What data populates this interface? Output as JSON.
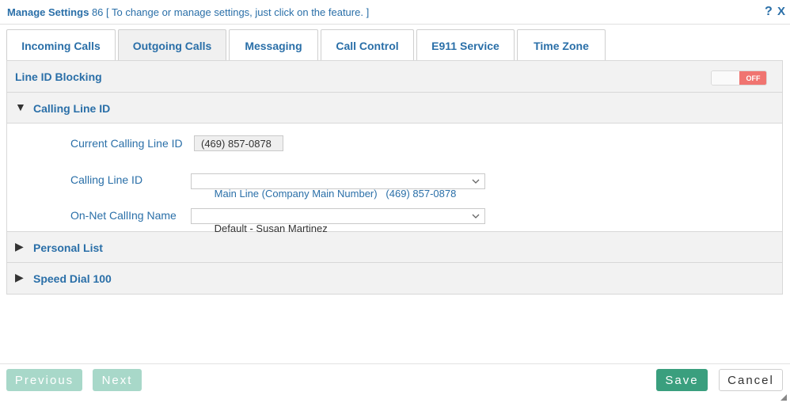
{
  "header": {
    "title": "Manage Settings",
    "subtitle": "- 86 [ To change or manage settings, just click on the feature. ]",
    "help_label": "?",
    "close_label": "X"
  },
  "tabs": [
    {
      "label": "Incoming Calls"
    },
    {
      "label": "Outgoing Calls"
    },
    {
      "label": "Messaging"
    },
    {
      "label": "Call Control"
    },
    {
      "label": "E911 Service"
    },
    {
      "label": "Time Zone"
    }
  ],
  "active_tab": "Outgoing Calls",
  "line_id_blocking": {
    "label": "Line ID Blocking",
    "toggle_state": "OFF"
  },
  "calling_line_id": {
    "arrow": "▼",
    "title": "Calling Line ID",
    "current_label": "Current Calling Line ID",
    "current_value": "(469) 857-0878",
    "select_label": "Calling Line ID",
    "select_value": "Main Line (Company Main Number)   (469) 857-0878",
    "name_label": "On-Net CallIng Name",
    "name_value": "Default - Susan Martinez"
  },
  "sections": [
    {
      "arrow": "▶",
      "title": "Personal List"
    },
    {
      "arrow": "▶",
      "title": "Speed Dial 100"
    }
  ],
  "footer": {
    "previous_label": "Previous",
    "next_label": "Next",
    "save_label": "Save",
    "cancel_label": "Cancel"
  },
  "colors": {
    "accent": "#2a6fa8",
    "toggle_off": "#f07470",
    "save": "#3a9f7e",
    "disabled": "#a8d8c9"
  }
}
